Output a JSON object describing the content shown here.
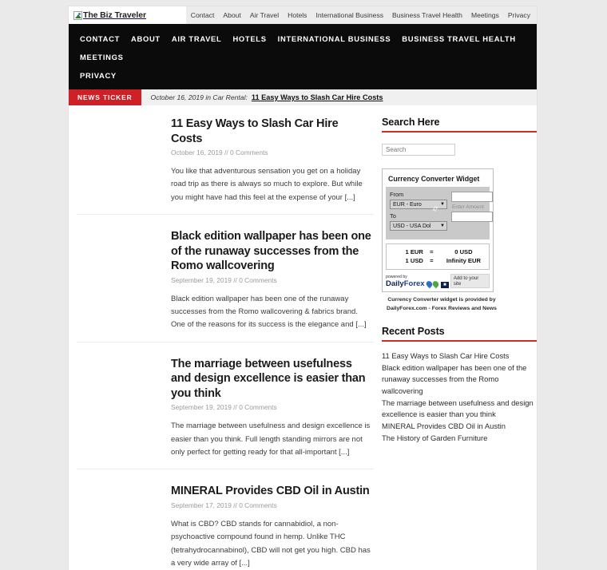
{
  "site": {
    "logo_alt": "The Biz Traveler",
    "broken_image_icon": "broken-image-icon"
  },
  "topnav": {
    "items": [
      {
        "label": "Contact"
      },
      {
        "label": "About"
      },
      {
        "label": "Air Travel"
      },
      {
        "label": "Hotels"
      },
      {
        "label": "International Business"
      },
      {
        "label": "Business Travel Health"
      },
      {
        "label": "Meetings"
      },
      {
        "label": "Privacy"
      }
    ]
  },
  "mainnav": {
    "items": [
      {
        "label": "CONTACT"
      },
      {
        "label": "ABOUT"
      },
      {
        "label": "AIR TRAVEL"
      },
      {
        "label": "HOTELS"
      },
      {
        "label": "INTERNATIONAL BUSINESS"
      },
      {
        "label": "BUSINESS TRAVEL HEALTH"
      },
      {
        "label": "MEETINGS"
      },
      {
        "label": "PRIVACY"
      }
    ]
  },
  "ticker": {
    "badge": "NEWS TICKER",
    "meta": "October 16, 2019 in Car Rental:",
    "title": "11 Easy Ways to Slash Car Hire Costs"
  },
  "posts": [
    {
      "title": "11 Easy Ways to Slash Car Hire Costs",
      "meta": "October 16, 2019 // 0 Comments",
      "excerpt": "You like that adventurous sensation you get on a holiday road trip as there is always so much to explore. But while you might have had this feel at the expense of your [...]"
    },
    {
      "title": "Black edition wallpaper has been one of the runaway successes from the Romo wallcovering",
      "meta": "September 19, 2019 // 0 Comments",
      "excerpt": "Black edition wallpaper has been one of the runaway successes from the Romo wallcovering & fabrics brand.  One of the reasons for its success is the elegance and [...]"
    },
    {
      "title": "The marriage between usefulness and design excellence is easier than you think",
      "meta": "September 19, 2019 // 0 Comments",
      "excerpt": "The marriage between usefulness and design excellence is easier than you think. Full length standing mirrors are not only perfect for getting ready for that all-important [...]"
    },
    {
      "title": "MINERAL Provides CBD Oil in Austin",
      "meta": "September 17, 2019 // 0 Comments",
      "excerpt": "What is CBD? CBD stands for cannabidiol, a non-psychoactive compound found in hemp. Unlike THC (tetrahydrocannabinol), CBD will not get you high. CBD has a very wide array of [...]"
    }
  ],
  "sidebar": {
    "search": {
      "title": "Search Here",
      "placeholder": "Search"
    },
    "currency": {
      "title": "Currency Converter Widget",
      "from_label": "From",
      "from_value": "EUR - Euro",
      "to_label": "To",
      "to_value": "USD - USA Dol",
      "amount_placeholder": "Enter Amount",
      "swap_icon": "swap-arrows-icon",
      "rates": [
        {
          "base": "1 EUR",
          "eq": "=",
          "result": "0 USD"
        },
        {
          "base": "1 USD",
          "eq": "=",
          "result": "Infinity EUR"
        }
      ],
      "powered_by": "powered by",
      "brand_part1": "Daily",
      "brand_part2": "Forex",
      "add_button": "Add to your site",
      "caption": "Currency Converter widget is provided by DailyForex.com - Forex Reviews and News"
    },
    "recent": {
      "title": "Recent Posts",
      "items": [
        {
          "label": "11 Easy Ways to Slash Car Hire Costs"
        },
        {
          "label": "Black edition wallpaper has been one of the runaway successes from the Romo wallcovering"
        },
        {
          "label": "The marriage between usefulness and design excellence is easier than you think"
        },
        {
          "label": "MINERAL Provides CBD Oil in Austin"
        },
        {
          "label": "The History of Garden Furniture"
        }
      ]
    }
  },
  "colors": {
    "accent_red": "#cf2027",
    "rule_red": "#d32a2a",
    "nav_black": "#0b0b0b",
    "body_gray": "#eaeaea"
  }
}
